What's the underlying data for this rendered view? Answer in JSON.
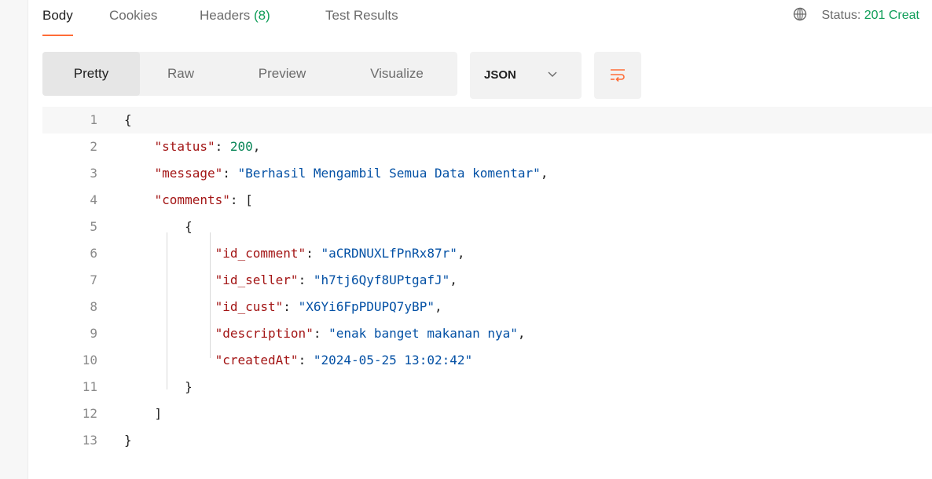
{
  "response_tabs": [
    {
      "label": "Body",
      "active": true
    },
    {
      "label": "Cookies",
      "active": false
    },
    {
      "label": "Headers",
      "count": "(8)",
      "active": false
    },
    {
      "label": "Test Results",
      "active": false
    }
  ],
  "status": {
    "label": "Status: ",
    "value": "201 Creat"
  },
  "view_modes": [
    {
      "label": "Pretty",
      "active": true
    },
    {
      "label": "Raw",
      "active": false
    },
    {
      "label": "Preview",
      "active": false
    },
    {
      "label": "Visualize",
      "active": false
    }
  ],
  "format": {
    "selected": "JSON"
  },
  "icons": {
    "globe": "globe-icon",
    "chevron": "chevron-down-icon",
    "wrap": "wrap-lines-icon"
  },
  "colors": {
    "accent": "#ff6c37",
    "success": "#0f9d58",
    "key": "#a31515",
    "string": "#0451a5",
    "number": "#098658"
  },
  "code": [
    {
      "n": "1",
      "parts": [
        {
          "t": "{",
          "c": "p"
        }
      ]
    },
    {
      "n": "2",
      "parts": [
        {
          "t": "    ",
          "c": "p"
        },
        {
          "t": "\"status\"",
          "c": "k"
        },
        {
          "t": ": ",
          "c": "p"
        },
        {
          "t": "200",
          "c": "n"
        },
        {
          "t": ",",
          "c": "p"
        }
      ]
    },
    {
      "n": "3",
      "parts": [
        {
          "t": "    ",
          "c": "p"
        },
        {
          "t": "\"message\"",
          "c": "k"
        },
        {
          "t": ": ",
          "c": "p"
        },
        {
          "t": "\"Berhasil Mengambil Semua Data komentar\"",
          "c": "s"
        },
        {
          "t": ",",
          "c": "p"
        }
      ]
    },
    {
      "n": "4",
      "parts": [
        {
          "t": "    ",
          "c": "p"
        },
        {
          "t": "\"comments\"",
          "c": "k"
        },
        {
          "t": ": [",
          "c": "p"
        }
      ]
    },
    {
      "n": "5",
      "parts": [
        {
          "t": "        {",
          "c": "p"
        }
      ]
    },
    {
      "n": "6",
      "parts": [
        {
          "t": "            ",
          "c": "p"
        },
        {
          "t": "\"id_comment\"",
          "c": "k"
        },
        {
          "t": ": ",
          "c": "p"
        },
        {
          "t": "\"aCRDNUXLfPnRx87r\"",
          "c": "s"
        },
        {
          "t": ",",
          "c": "p"
        }
      ]
    },
    {
      "n": "7",
      "parts": [
        {
          "t": "            ",
          "c": "p"
        },
        {
          "t": "\"id_seller\"",
          "c": "k"
        },
        {
          "t": ": ",
          "c": "p"
        },
        {
          "t": "\"h7tj6Qyf8UPtgafJ\"",
          "c": "s"
        },
        {
          "t": ",",
          "c": "p"
        }
      ]
    },
    {
      "n": "8",
      "parts": [
        {
          "t": "            ",
          "c": "p"
        },
        {
          "t": "\"id_cust\"",
          "c": "k"
        },
        {
          "t": ": ",
          "c": "p"
        },
        {
          "t": "\"X6Yi6FpPDUPQ7yBP\"",
          "c": "s"
        },
        {
          "t": ",",
          "c": "p"
        }
      ]
    },
    {
      "n": "9",
      "parts": [
        {
          "t": "            ",
          "c": "p"
        },
        {
          "t": "\"description\"",
          "c": "k"
        },
        {
          "t": ": ",
          "c": "p"
        },
        {
          "t": "\"enak banget makanan nya\"",
          "c": "s"
        },
        {
          "t": ",",
          "c": "p"
        }
      ]
    },
    {
      "n": "10",
      "parts": [
        {
          "t": "            ",
          "c": "p"
        },
        {
          "t": "\"createdAt\"",
          "c": "k"
        },
        {
          "t": ": ",
          "c": "p"
        },
        {
          "t": "\"2024-05-25 13:02:42\"",
          "c": "s"
        }
      ]
    },
    {
      "n": "11",
      "parts": [
        {
          "t": "        }",
          "c": "p"
        }
      ]
    },
    {
      "n": "12",
      "parts": [
        {
          "t": "    ]",
          "c": "p"
        }
      ]
    },
    {
      "n": "13",
      "parts": [
        {
          "t": "}",
          "c": "p"
        }
      ]
    }
  ]
}
